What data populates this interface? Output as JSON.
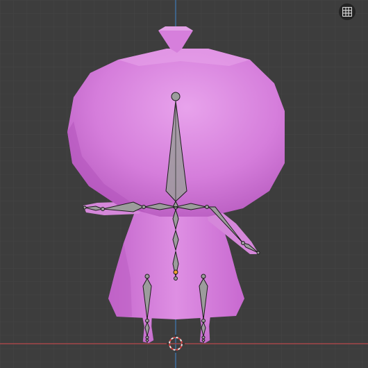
{
  "viewport": {
    "background": "#3d3d3d",
    "grid_minor_color": "#454545",
    "grid_major_color": "#4e4e4e",
    "x_axis_color": "#a5464a",
    "z_axis_color": "#3f6e9e",
    "view": "front-orthographic"
  },
  "character": {
    "body_color": "#d57ddb",
    "body_shadow_color": "#b454bd",
    "body_highlight_color": "#e296e6"
  },
  "armature": {
    "bone_fill": "#9c9c9c",
    "bone_outline": "#1a1a1a",
    "active_joint_color": "#f0a030"
  },
  "gizmos": {
    "toggle_grid_icon": "grid-icon",
    "cursor_icon": "3d-cursor-icon"
  }
}
